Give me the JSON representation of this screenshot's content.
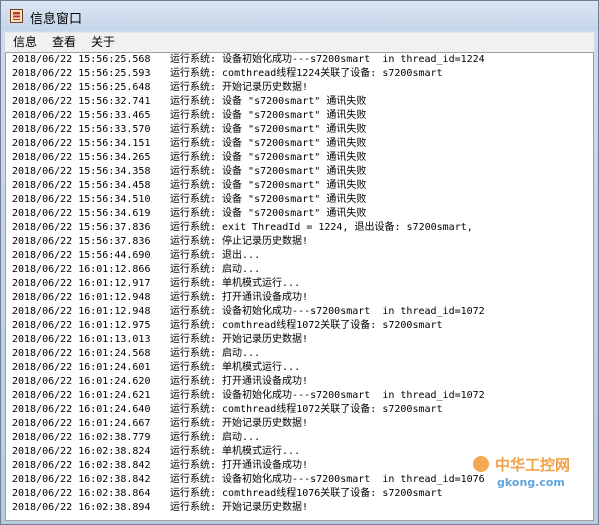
{
  "window": {
    "title": "信息窗口"
  },
  "menu": {
    "items": [
      "信息",
      "查看",
      "关于"
    ]
  },
  "log": [
    {
      "time": "2018/06/22 15:56:25.568",
      "msg": "运行系统: 设备初始化成功---s7200smart  in thread_id=1224"
    },
    {
      "time": "2018/06/22 15:56:25.593",
      "msg": "运行系统: comthread线程1224关联了设备: s7200smart"
    },
    {
      "time": "2018/06/22 15:56:25.648",
      "msg": "运行系统: 开始记录历史数据!"
    },
    {
      "time": "2018/06/22 15:56:32.741",
      "msg": "运行系统: 设备 \"s7200smart\" 通讯失败"
    },
    {
      "time": "2018/06/22 15:56:33.465",
      "msg": "运行系统: 设备 \"s7200smart\" 通讯失败"
    },
    {
      "time": "2018/06/22 15:56:33.570",
      "msg": "运行系统: 设备 \"s7200smart\" 通讯失败"
    },
    {
      "time": "2018/06/22 15:56:34.151",
      "msg": "运行系统: 设备 \"s7200smart\" 通讯失败"
    },
    {
      "time": "2018/06/22 15:56:34.265",
      "msg": "运行系统: 设备 \"s7200smart\" 通讯失败"
    },
    {
      "time": "2018/06/22 15:56:34.358",
      "msg": "运行系统: 设备 \"s7200smart\" 通讯失败"
    },
    {
      "time": "2018/06/22 15:56:34.458",
      "msg": "运行系统: 设备 \"s7200smart\" 通讯失败"
    },
    {
      "time": "2018/06/22 15:56:34.510",
      "msg": "运行系统: 设备 \"s7200smart\" 通讯失败"
    },
    {
      "time": "2018/06/22 15:56:34.619",
      "msg": "运行系统: 设备 \"s7200smart\" 通讯失败"
    },
    {
      "time": "2018/06/22 15:56:37.836",
      "msg": "运行系统: exit ThreadId = 1224, 退出设备: s7200smart,"
    },
    {
      "time": "2018/06/22 15:56:37.836",
      "msg": "运行系统: 停止记录历史数据!"
    },
    {
      "time": "2018/06/22 15:56:44.690",
      "msg": "运行系统: 退出..."
    },
    {
      "time": "2018/06/22 16:01:12.866",
      "msg": "运行系统: 启动..."
    },
    {
      "time": "2018/06/22 16:01:12.917",
      "msg": "运行系统: 单机模式运行..."
    },
    {
      "time": "2018/06/22 16:01:12.948",
      "msg": "运行系统: 打开通讯设备成功!"
    },
    {
      "time": "2018/06/22 16:01:12.948",
      "msg": "运行系统: 设备初始化成功---s7200smart  in thread_id=1072"
    },
    {
      "time": "2018/06/22 16:01:12.975",
      "msg": "运行系统: comthread线程1072关联了设备: s7200smart"
    },
    {
      "time": "2018/06/22 16:01:13.013",
      "msg": "运行系统: 开始记录历史数据!"
    },
    {
      "time": "2018/06/22 16:01:24.568",
      "msg": "运行系统: 启动..."
    },
    {
      "time": "2018/06/22 16:01:24.601",
      "msg": "运行系统: 单机模式运行..."
    },
    {
      "time": "2018/06/22 16:01:24.620",
      "msg": "运行系统: 打开通讯设备成功!"
    },
    {
      "time": "2018/06/22 16:01:24.621",
      "msg": "运行系统: 设备初始化成功---s7200smart  in thread_id=1072"
    },
    {
      "time": "2018/06/22 16:01:24.640",
      "msg": "运行系统: comthread线程1072关联了设备: s7200smart"
    },
    {
      "time": "2018/06/22 16:01:24.667",
      "msg": "运行系统: 开始记录历史数据!"
    },
    {
      "time": "2018/06/22 16:02:38.779",
      "msg": "运行系统: 启动..."
    },
    {
      "time": "2018/06/22 16:02:38.824",
      "msg": "运行系统: 单机模式运行..."
    },
    {
      "time": "2018/06/22 16:02:38.842",
      "msg": "运行系统: 打开通讯设备成功!"
    },
    {
      "time": "2018/06/22 16:02:38.842",
      "msg": "运行系统: 设备初始化成功---s7200smart  in thread_id=1076"
    },
    {
      "time": "2018/06/22 16:02:38.864",
      "msg": "运行系统: comthread线程1076关联了设备: s7200smart"
    },
    {
      "time": "2018/06/22 16:02:38.894",
      "msg": "运行系统: 开始记录历史数据!"
    }
  ],
  "watermark": {
    "brand": "中华工控网",
    "url": "gkong.com"
  }
}
